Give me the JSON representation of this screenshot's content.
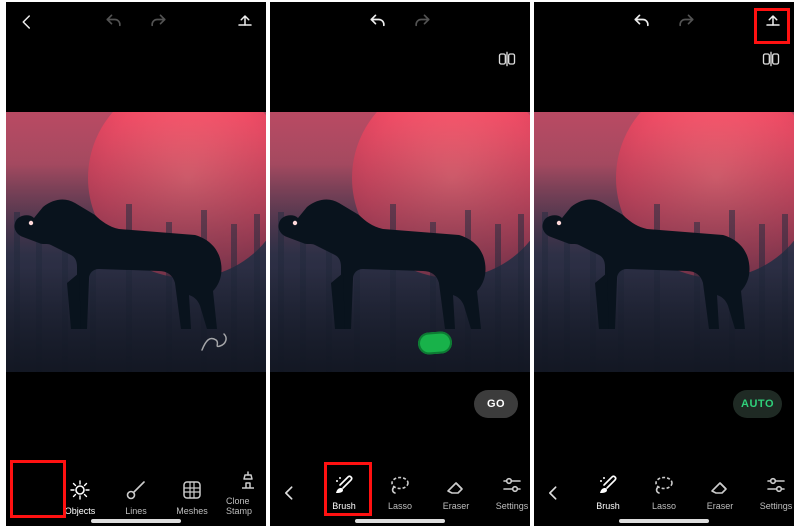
{
  "screens": {
    "s1": {
      "toolbar": {
        "items": [
          {
            "label": "Objects",
            "name": "tool-objects"
          },
          {
            "label": "Lines",
            "name": "tool-lines"
          },
          {
            "label": "Meshes",
            "name": "tool-meshes"
          },
          {
            "label": "Clone Stamp",
            "name": "tool-clonestamp"
          }
        ],
        "active_index": 0
      }
    },
    "s2": {
      "toolbar": {
        "items": [
          {
            "label": "Brush",
            "name": "tool-brush"
          },
          {
            "label": "Lasso",
            "name": "tool-lasso"
          },
          {
            "label": "Eraser",
            "name": "tool-eraser"
          },
          {
            "label": "Settings",
            "name": "tool-settings"
          }
        ],
        "active_index": 0
      },
      "action_chip": "GO"
    },
    "s3": {
      "toolbar": {
        "items": [
          {
            "label": "Brush",
            "name": "tool-brush"
          },
          {
            "label": "Lasso",
            "name": "tool-lasso"
          },
          {
            "label": "Eraser",
            "name": "tool-eraser"
          },
          {
            "label": "Settings",
            "name": "tool-settings"
          }
        ],
        "active_index": 0
      },
      "action_chip": "AUTO"
    }
  },
  "icons": {
    "back": "back-icon",
    "undo": "undo-icon",
    "redo": "redo-icon",
    "export": "export-icon",
    "compare": "compare-icon",
    "objects": "objects-icon",
    "lines": "lines-icon",
    "meshes": "meshes-icon",
    "clonestamp": "clonestamp-icon",
    "brush": "brush-icon",
    "lasso": "lasso-icon",
    "eraser": "eraser-icon",
    "settings": "settings-icon",
    "arrowleft": "arrow-left-icon"
  },
  "colors": {
    "highlight": "#ff1111",
    "auto": "#2fd07a"
  }
}
